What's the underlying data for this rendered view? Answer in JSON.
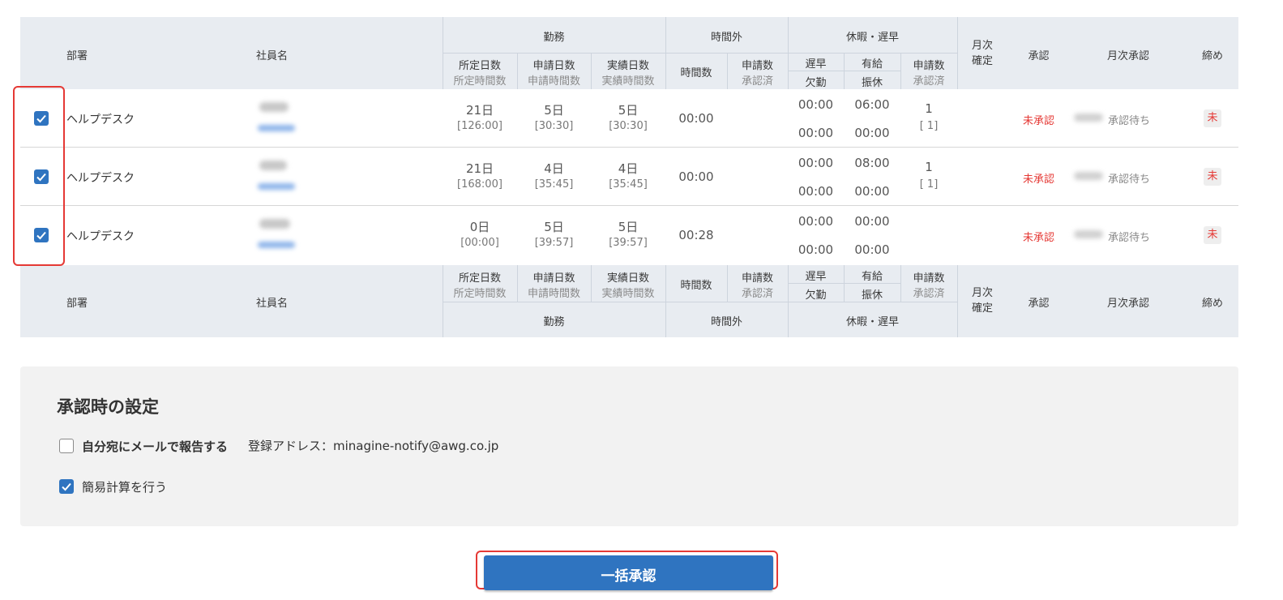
{
  "table": {
    "header": {
      "dept": "部署",
      "employee": "社員名",
      "work_group": "勤務",
      "overtime_group": "時間外",
      "leave_group": "休暇・遅早",
      "monthly_confirm": "月次\n確定",
      "approve": "承認",
      "monthly_approve": "月次承認",
      "close": "締め",
      "scheduled_days": "所定日数",
      "scheduled_hours": "所定時間数",
      "applied_days": "申請日数",
      "applied_hours": "申請時間数",
      "actual_days": "実績日数",
      "actual_hours": "実績時間数",
      "ot_hours": "時間数",
      "ot_requests": "申請数",
      "ot_approved": "承認済",
      "late_early": "遅早",
      "absence": "欠勤",
      "paid_leave": "有給",
      "comp_holiday": "振休",
      "leave_requests": "申請数",
      "leave_approved": "承認済"
    },
    "rows": [
      {
        "checked": true,
        "dept": "ヘルプデスク",
        "scheduled_days": "21日",
        "scheduled_hours": "[126:00]",
        "applied_days": "5日",
        "applied_hours": "[30:30]",
        "actual_days": "5日",
        "actual_hours": "[30:30]",
        "ot_hours": "00:00",
        "late_early": "00:00",
        "absence": "00:00",
        "paid_leave": "06:00",
        "comp_holiday": "00:00",
        "leave_requests": "1",
        "leave_approved": "[ 1]",
        "approve_status": "未承認",
        "monthly_status": "承認待ち",
        "close_status": "未"
      },
      {
        "checked": true,
        "dept": "ヘルプデスク",
        "scheduled_days": "21日",
        "scheduled_hours": "[168:00]",
        "applied_days": "4日",
        "applied_hours": "[35:45]",
        "actual_days": "4日",
        "actual_hours": "[35:45]",
        "ot_hours": "00:00",
        "late_early": "00:00",
        "absence": "00:00",
        "paid_leave": "08:00",
        "comp_holiday": "00:00",
        "leave_requests": "1",
        "leave_approved": "[ 1]",
        "approve_status": "未承認",
        "monthly_status": "承認待ち",
        "close_status": "未"
      },
      {
        "checked": true,
        "dept": "ヘルプデスク",
        "scheduled_days": "0日",
        "scheduled_hours": "[00:00]",
        "applied_days": "5日",
        "applied_hours": "[39:57]",
        "actual_days": "5日",
        "actual_hours": "[39:57]",
        "ot_hours": "00:28",
        "late_early": "00:00",
        "absence": "00:00",
        "paid_leave": "00:00",
        "comp_holiday": "00:00",
        "leave_requests": "",
        "leave_approved": "",
        "approve_status": "未承認",
        "monthly_status": "承認待ち",
        "close_status": "未"
      }
    ]
  },
  "settings": {
    "title": "承認時の設定",
    "email_label": "自分宛にメールで報告する",
    "email_checked": false,
    "registered_address": "登録アドレス：minagine-notify@awg.co.jp",
    "simple_calc_label": "簡易計算を行う",
    "simple_calc_checked": true
  },
  "bulk_approve_label": "一括承認",
  "colors": {
    "accent": "#2f74c0",
    "header_bg": "#e8ecf1",
    "warning_red": "#e53935",
    "highlight_box": "#e53935"
  }
}
